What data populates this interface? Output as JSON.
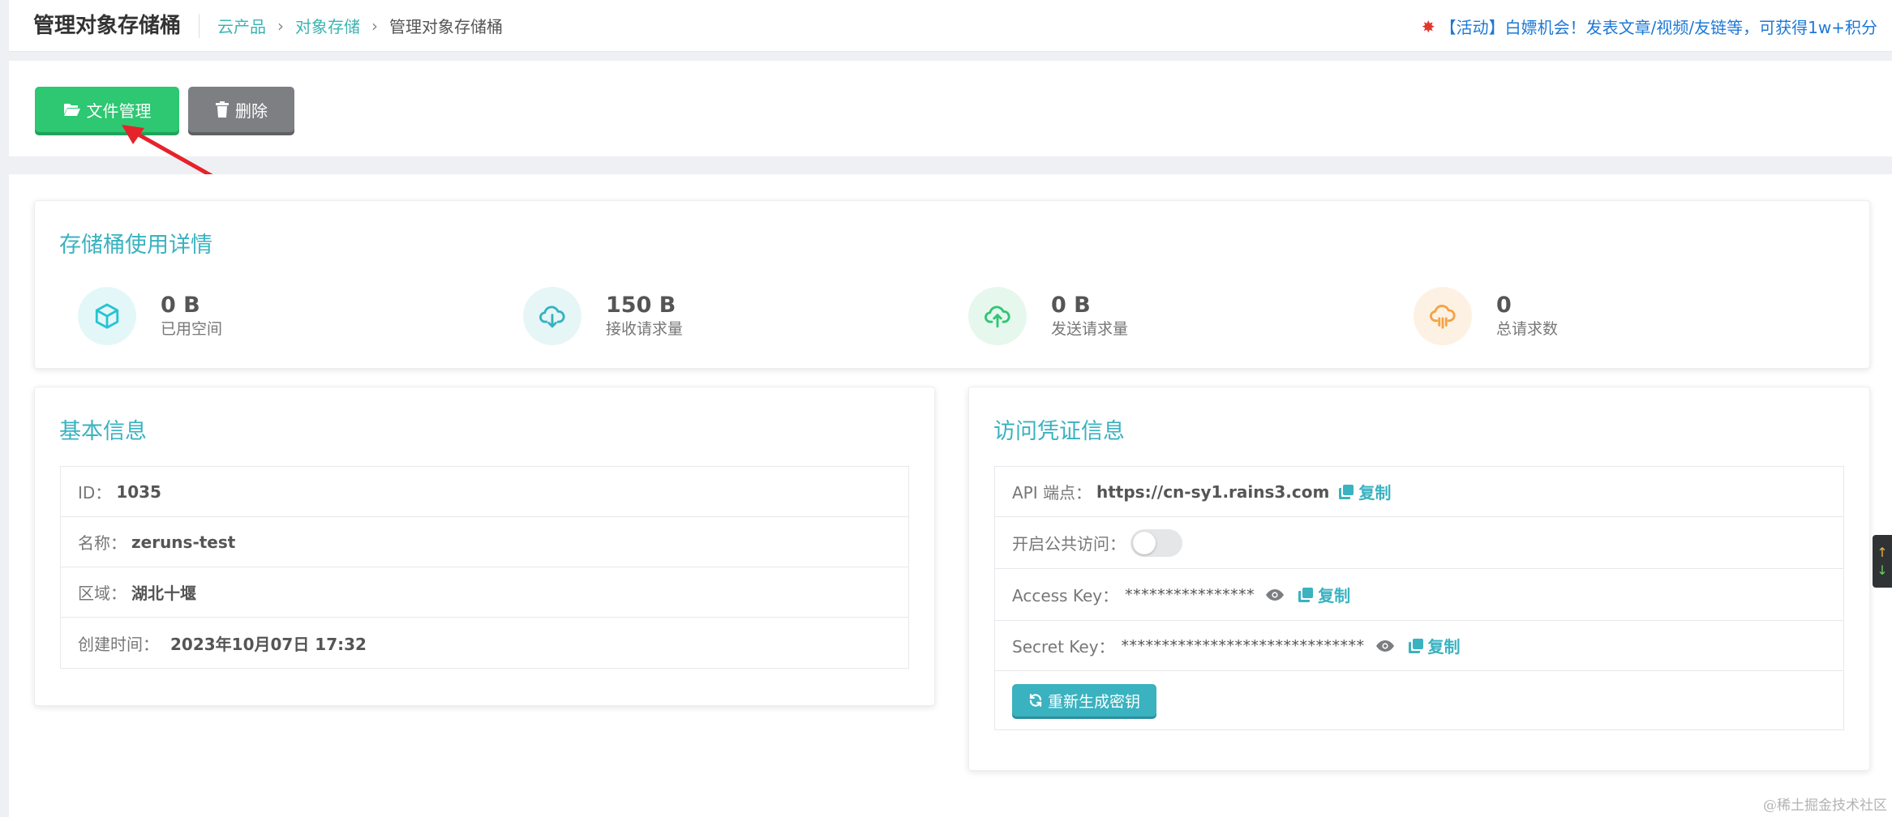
{
  "header": {
    "title": "管理对象存储桶",
    "breadcrumb": [
      "云产品",
      "对象存储",
      "管理对象存储桶"
    ],
    "promo_text": "【活动】白嫖机会！发表文章/视频/友链等，可获得1w+积分",
    "promo_icon": "burst-icon"
  },
  "toolbar": {
    "file_manage_label": "文件管理",
    "delete_label": "删除",
    "file_manage_icon": "folder-open-icon",
    "delete_icon": "trash-icon"
  },
  "usage": {
    "title": "存储桶使用详情",
    "stats": [
      {
        "value": "0 B",
        "label": "已用空间",
        "icon": "cube-icon",
        "color": "#27c3d3",
        "bg": "#e3f7f9"
      },
      {
        "value": "150 B",
        "label": "接收请求量",
        "icon": "cloud-download-icon",
        "color": "#35b2c0",
        "bg": "#e6f5f6"
      },
      {
        "value": "0 B",
        "label": "发送请求量",
        "icon": "cloud-upload-icon",
        "color": "#2ec772",
        "bg": "#e6f7ee"
      },
      {
        "value": "0",
        "label": "总请求数",
        "icon": "cloud-rain-icon",
        "color": "#f5a344",
        "bg": "#fdf1e4"
      }
    ]
  },
  "basic": {
    "title": "基本信息",
    "rows": [
      {
        "label": "ID：",
        "value": "1035"
      },
      {
        "label": "名称：",
        "value": "zeruns-test"
      },
      {
        "label": "区域：",
        "value": "湖北十堰"
      },
      {
        "label": "创建时间：",
        "value": "2023年10月07日 17:32"
      }
    ]
  },
  "credentials": {
    "title": "访问凭证信息",
    "api_label": "API 端点：",
    "api_value": "https://cn-sy1.rains3.com",
    "copy_label": "复制",
    "public_label": "开启公共访问：",
    "public_enabled": false,
    "access_label": "Access Key：",
    "access_value": "****************",
    "secret_label": "Secret Key：",
    "secret_value": "******************************",
    "regen_label": "重新生成密钥"
  },
  "side_widget": {
    "up": "↑",
    "down": "↓"
  },
  "watermark": "@稀土掘金技术社区",
  "colors": {
    "accent": "#3ab2c0",
    "green": "#2ec772",
    "gray": "#7d7f82",
    "link": "#1d78d6"
  }
}
